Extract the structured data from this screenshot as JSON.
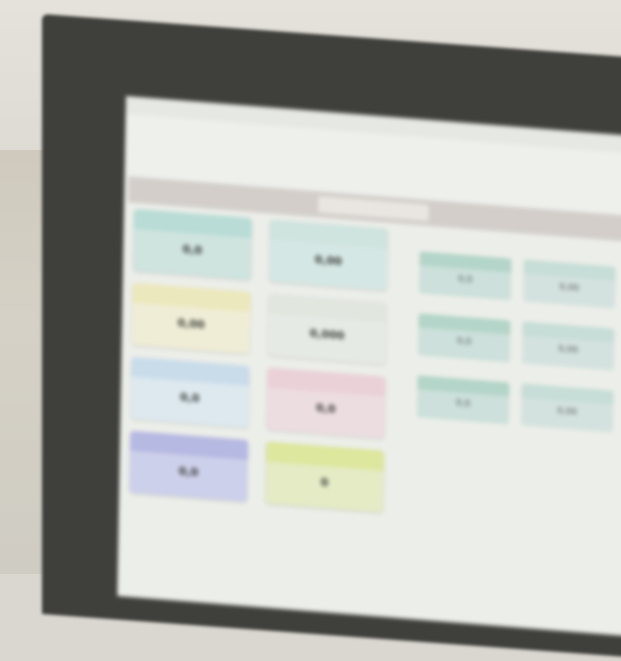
{
  "colors": {
    "tile_teal": "#b9dcd6",
    "tile_yellow": "#ece8bd",
    "tile_blue": "#c9dcea",
    "tile_pink": "#ead1d8",
    "tile_violet": "#b6b9e2",
    "tile_lime": "#dde79d",
    "tile_green": "#cfe3df",
    "side_green": "#b4d5c9"
  },
  "dashboard": {
    "tiles": [
      {
        "value": "0,0"
      },
      {
        "value": "0,00"
      },
      {
        "value": "0,00"
      },
      {
        "value": "0,000"
      },
      {
        "value": "0,0"
      },
      {
        "value": "0,0"
      },
      {
        "value": "0,0"
      },
      {
        "value": "0"
      }
    ],
    "side_tiles": [
      {
        "value": "0,0"
      },
      {
        "value": "0,00"
      },
      {
        "value": "0,0"
      },
      {
        "value": "0,00"
      },
      {
        "value": "0,0"
      },
      {
        "value": "0,00"
      }
    ]
  }
}
